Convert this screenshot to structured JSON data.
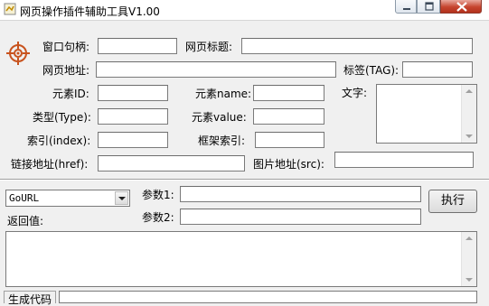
{
  "window": {
    "title": "网页操作插件辅助工具V1.00"
  },
  "form": {
    "window_handle_label": "窗口句柄:",
    "page_title_label": "网页标题:",
    "page_url_label": "网页地址:",
    "tag_label": "标签(TAG):",
    "element_id_label": "元素ID:",
    "element_name_label": "元素name:",
    "text_label": "文字:",
    "type_label": "类型(Type):",
    "element_value_label": "元素value:",
    "index_label": "索引(index):",
    "frame_index_label": "框架索引:",
    "href_label": "链接地址(href):",
    "img_src_label": "图片地址(src):"
  },
  "action": {
    "command_selected": "GoURL",
    "param1_label": "参数1:",
    "param2_label": "参数2:",
    "execute_button": "执行",
    "return_label": "返回值:"
  },
  "bottom": {
    "generate_code_tab": "生成代码"
  },
  "colors": {
    "window_bg": "#f0f0f0",
    "close_button": "#c6452f",
    "crosshair_icon": "#c8531e"
  }
}
